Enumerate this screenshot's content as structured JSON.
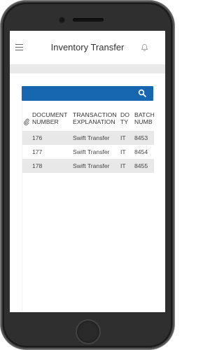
{
  "app": {
    "title": "Inventory Transfer"
  },
  "table": {
    "headers": {
      "document_number": "DOCUMENT\nNUMBER",
      "transaction_explanation": "TRANSACTION\nEXPLANATION",
      "doc_type": "DO\nTY",
      "batch_number": "BATCH\nNUMB"
    },
    "rows": [
      {
        "document_number": "176",
        "explanation": "Swift Transfer",
        "doc_type": "IT",
        "batch_number": "8453"
      },
      {
        "document_number": "177",
        "explanation": "Swift Transfer",
        "doc_type": "IT",
        "batch_number": "8454"
      },
      {
        "document_number": "178",
        "explanation": "Swift Transfer",
        "doc_type": "IT",
        "batch_number": "8455"
      }
    ]
  },
  "colors": {
    "search_bar": "#1767b0",
    "row_stripe": "#e8e8e8",
    "band": "#e9e9e9"
  },
  "icons": {
    "menu": "hamburger-menu-icon",
    "notifications": "bell-icon",
    "search": "search-icon",
    "attachment": "paperclip-icon"
  }
}
